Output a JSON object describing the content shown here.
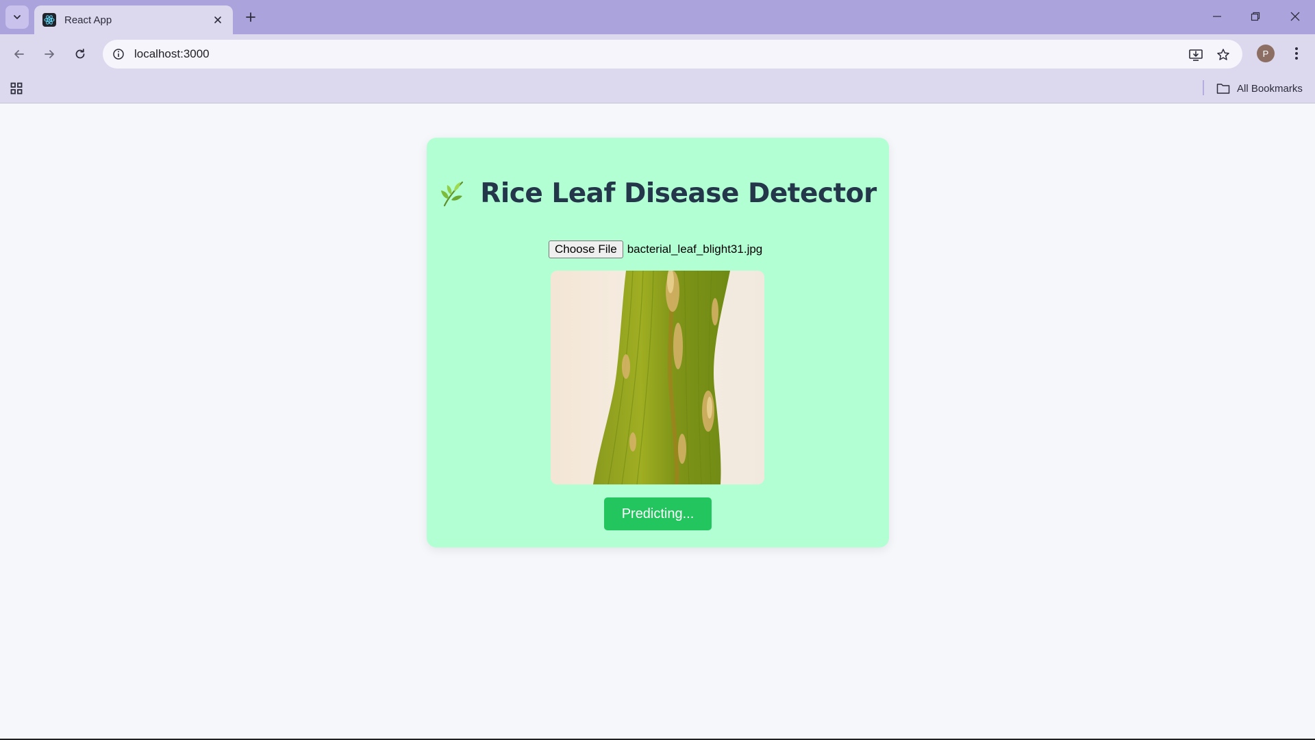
{
  "browser": {
    "tab_title": "React App",
    "url": "localhost:3000",
    "profile_initial": "P",
    "bookmarks_label": "All Bookmarks"
  },
  "app": {
    "title": "Rice Leaf Disease Detector",
    "file_button_label": "Choose File",
    "selected_file_name": "bacterial_leaf_blight31.jpg",
    "predict_button_label": "Predicting...",
    "accent_color": "#22c55e",
    "card_color": "#b2ffd3",
    "title_color": "#23364a"
  },
  "icons": {
    "tab_search": "chevron-down-icon",
    "favicon": "react-icon",
    "close": "close-icon",
    "new_tab": "plus-icon",
    "back": "arrow-left-icon",
    "forward": "arrow-right-icon",
    "reload": "reload-icon",
    "site_info": "info-icon",
    "install": "install-app-icon",
    "bookmark": "star-icon",
    "menu": "kebab-menu-icon",
    "apps": "apps-grid-icon",
    "folder": "folder-icon",
    "title_emoji": "herb-leaf-icon"
  }
}
